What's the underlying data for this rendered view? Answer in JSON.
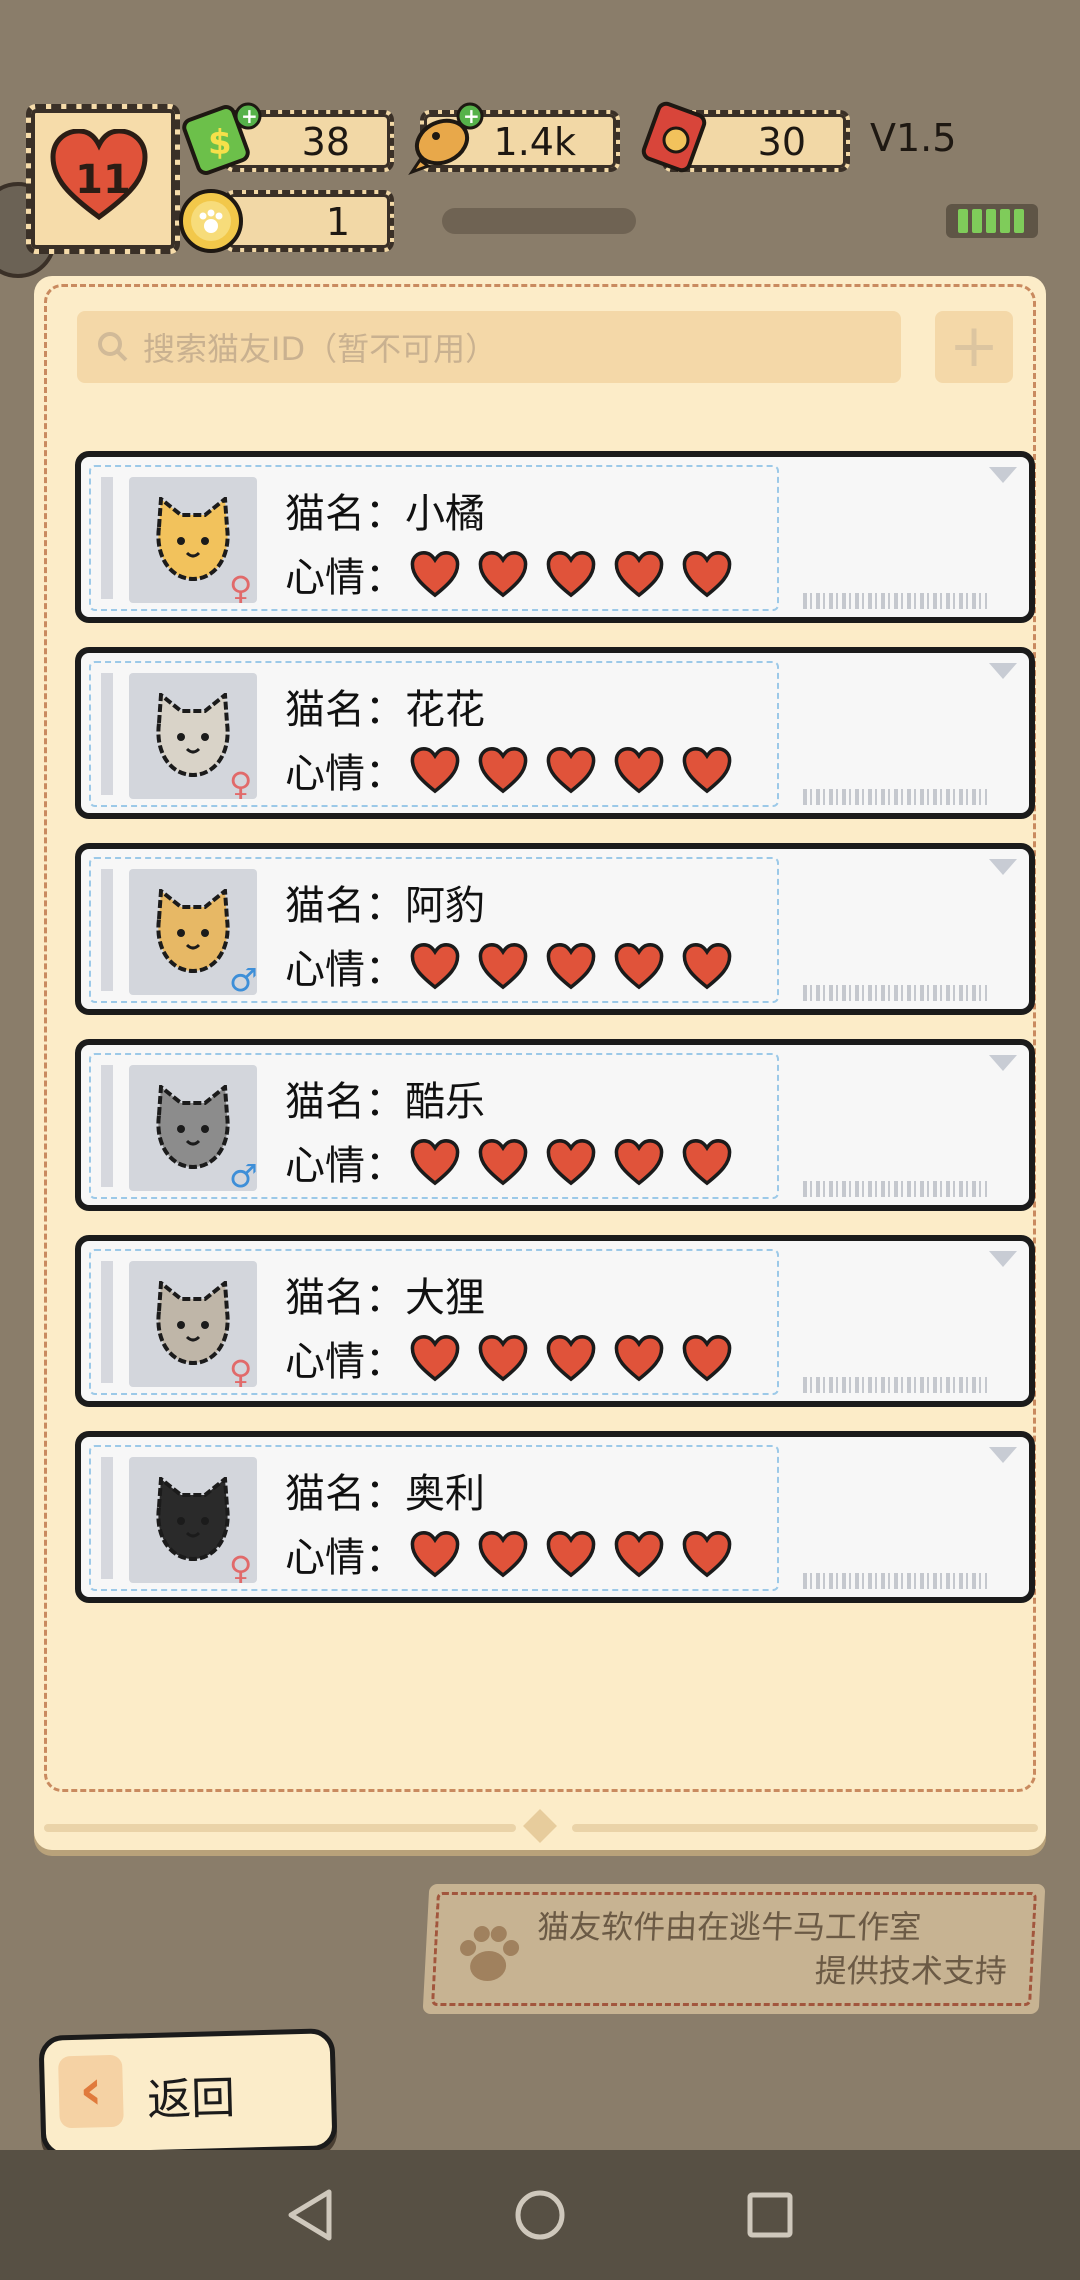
{
  "hud": {
    "lives": "11",
    "resources": [
      {
        "name": "cash",
        "icon": "cash-icon",
        "value": "38",
        "has_plus": true
      },
      {
        "name": "fish",
        "icon": "fish-snack-icon",
        "value": "1.4k",
        "has_plus": true
      },
      {
        "name": "can",
        "icon": "cat-food-can-icon",
        "value": "30",
        "has_plus": false
      }
    ],
    "coins": {
      "icon": "paw-coin-icon",
      "value": "1"
    },
    "version": "V1.5"
  },
  "search": {
    "placeholder": "搜索猫友ID（暂不可用）",
    "add_label": "+"
  },
  "cats": [
    {
      "name_label": "猫名：",
      "name": "小橘",
      "mood_label": "心情：",
      "mood_hearts": 5,
      "gender": "♀",
      "avatar_color": "#f2c25c"
    },
    {
      "name_label": "猫名：",
      "name": "花花",
      "mood_label": "心情：",
      "mood_hearts": 5,
      "gender": "♀",
      "avatar_color": "#d9d3c8"
    },
    {
      "name_label": "猫名：",
      "name": "阿豹",
      "mood_label": "心情：",
      "mood_hearts": 5,
      "gender": "♂",
      "avatar_color": "#e7b865"
    },
    {
      "name_label": "猫名：",
      "name": "酷乐",
      "mood_label": "心情：",
      "mood_hearts": 5,
      "gender": "♂",
      "avatar_color": "#8c8c8c"
    },
    {
      "name_label": "猫名：",
      "name": "大狸",
      "mood_label": "心情：",
      "mood_hearts": 5,
      "gender": "♀",
      "avatar_color": "#bfb6a8"
    },
    {
      "name_label": "猫名：",
      "name": "奥利",
      "mood_label": "心情：",
      "mood_hearts": 5,
      "gender": "♀",
      "avatar_color": "#2a2a2a"
    }
  ],
  "credit": {
    "line1": "猫友软件由在逃牛马工作室",
    "line2": "提供技术支持"
  },
  "back_button": {
    "label": "返回"
  },
  "colors": {
    "heart": "#e0533a",
    "female": "#e16a6a",
    "male": "#3e8fd8"
  }
}
